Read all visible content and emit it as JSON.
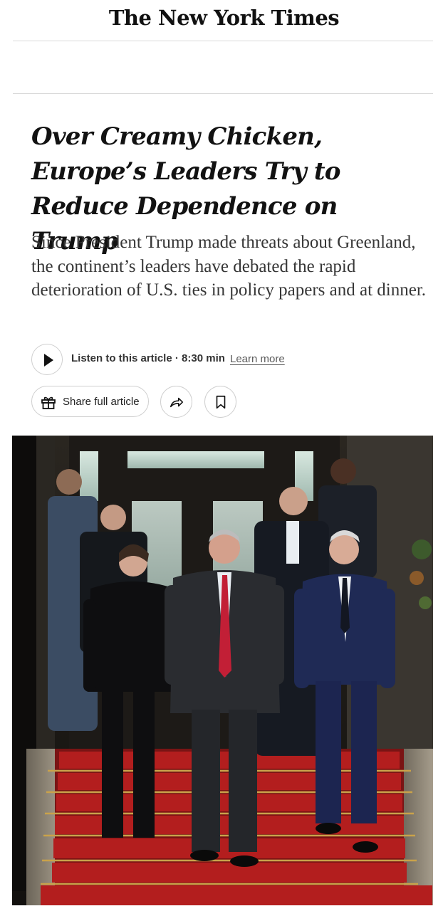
{
  "masthead": {
    "title": "The New York Times"
  },
  "article": {
    "headline": "Over Creamy Chicken, Europe’s Leaders Try to Reduce Dependence on Trump",
    "summary": "Since President Trump made threats about Greenland, the continent’s leaders have debated the rapid deterioration of U.S. ties in policy papers and at dinner."
  },
  "audio": {
    "label": "Listen to this article",
    "separator": "·",
    "duration": "8:30 min",
    "learn_more": "Learn more",
    "play_icon": "play-icon"
  },
  "actions": {
    "share_label": "Share full article",
    "share_icon": "gift-icon",
    "forward_icon": "share-arrow-icon",
    "save_icon": "bookmark-icon"
  },
  "colors": {
    "text": "#121212",
    "summary_text": "#363636",
    "border": "#cfcfcf",
    "carpet": "#b31e1e"
  }
}
